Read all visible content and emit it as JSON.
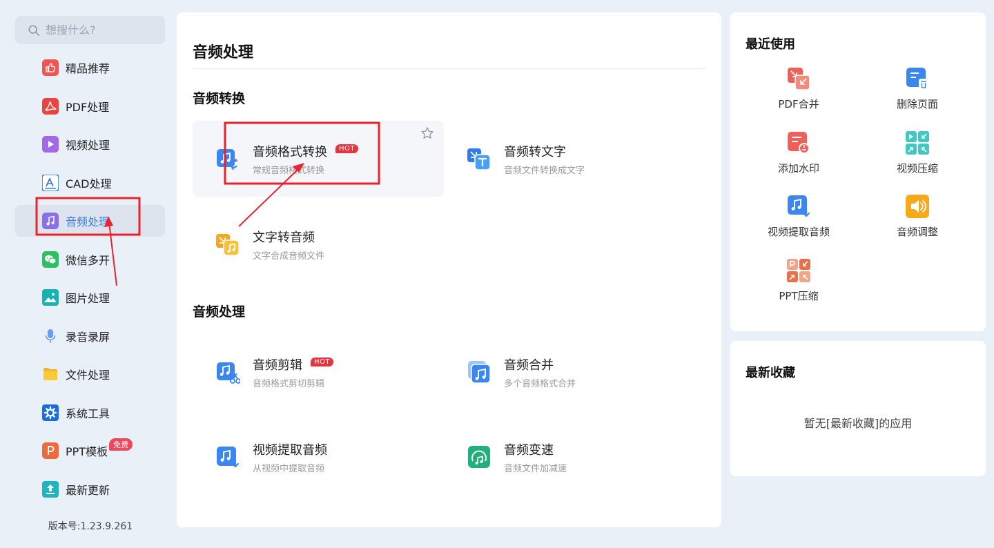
{
  "search": {
    "placeholder": "想搜什么?"
  },
  "sidebar": {
    "items": [
      {
        "label": "精品推荐"
      },
      {
        "label": "PDF处理"
      },
      {
        "label": "视频处理"
      },
      {
        "label": "CAD处理"
      },
      {
        "label": "音频处理"
      },
      {
        "label": "微信多开"
      },
      {
        "label": "图片处理"
      },
      {
        "label": "录音录屏"
      },
      {
        "label": "文件处理"
      },
      {
        "label": "系统工具"
      },
      {
        "label": "PPT模板",
        "badge": "免费"
      },
      {
        "label": "最新更新"
      }
    ],
    "active_index": 4,
    "version": "版本号:1.23.9.261"
  },
  "main": {
    "title": "音频处理",
    "sections": [
      {
        "title": "音频转换",
        "tools": [
          {
            "name": "音频格式转换",
            "desc": "常规音频格式转换",
            "badge": "HOT"
          },
          {
            "name": "音频转文字",
            "desc": "音频文件转换成文字"
          },
          {
            "name": "文字转音频",
            "desc": "文字合成音频文件"
          }
        ]
      },
      {
        "title": "音频处理",
        "tools": [
          {
            "name": "音频剪辑",
            "desc": "音频格式剪切剪辑",
            "badge": "HOT"
          },
          {
            "name": "音频合并",
            "desc": "多个音频格式合并"
          },
          {
            "name": "视频提取音频",
            "desc": "从视频中提取音频"
          },
          {
            "name": "音频变速",
            "desc": "音频文件加减速"
          }
        ]
      }
    ]
  },
  "recent": {
    "title": "最近使用",
    "items": [
      {
        "label": "PDF合并"
      },
      {
        "label": "删除页面"
      },
      {
        "label": "添加水印"
      },
      {
        "label": "视频压缩"
      },
      {
        "label": "视频提取音频"
      },
      {
        "label": "音频调整"
      },
      {
        "label": "PPT压缩"
      }
    ]
  },
  "favorites": {
    "title": "最新收藏",
    "empty_text": "暂无[最新收藏]的应用"
  },
  "colors": {
    "accent": "#3b7ce6",
    "hot": "#e8333f",
    "annotation": "#e8232c",
    "background": "#eaf0f8"
  }
}
